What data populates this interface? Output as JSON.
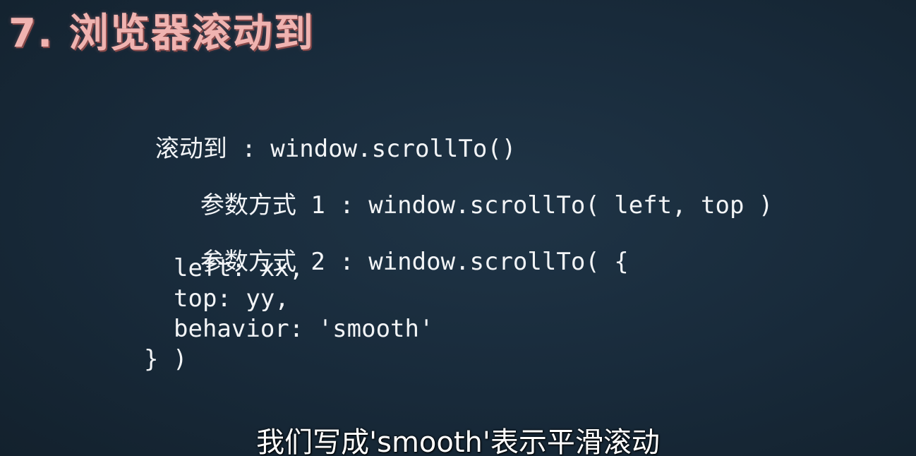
{
  "slide": {
    "title": "7. 浏览器滚动到",
    "line_main_prefix": "滚动到",
    "line_main_code": " : window.scrollTo()",
    "param1_prefix": "参数方式",
    "param1_code": " 1 : window.scrollTo( left, top )",
    "param2_prefix": "参数方式",
    "param2_code": " 2 : window.scrollTo( {",
    "param2_left": "left: xx,",
    "param2_top": "top: yy,",
    "param2_behavior": "behavior: 'smooth'",
    "param2_close": "} )"
  },
  "subtitle": {
    "text": "我们写成'smooth'表示平滑滚动"
  },
  "colors": {
    "background": "#182a3a",
    "title": "#f0b3b0",
    "code": "#f2f4f6",
    "subtitle": "#ffffff"
  }
}
